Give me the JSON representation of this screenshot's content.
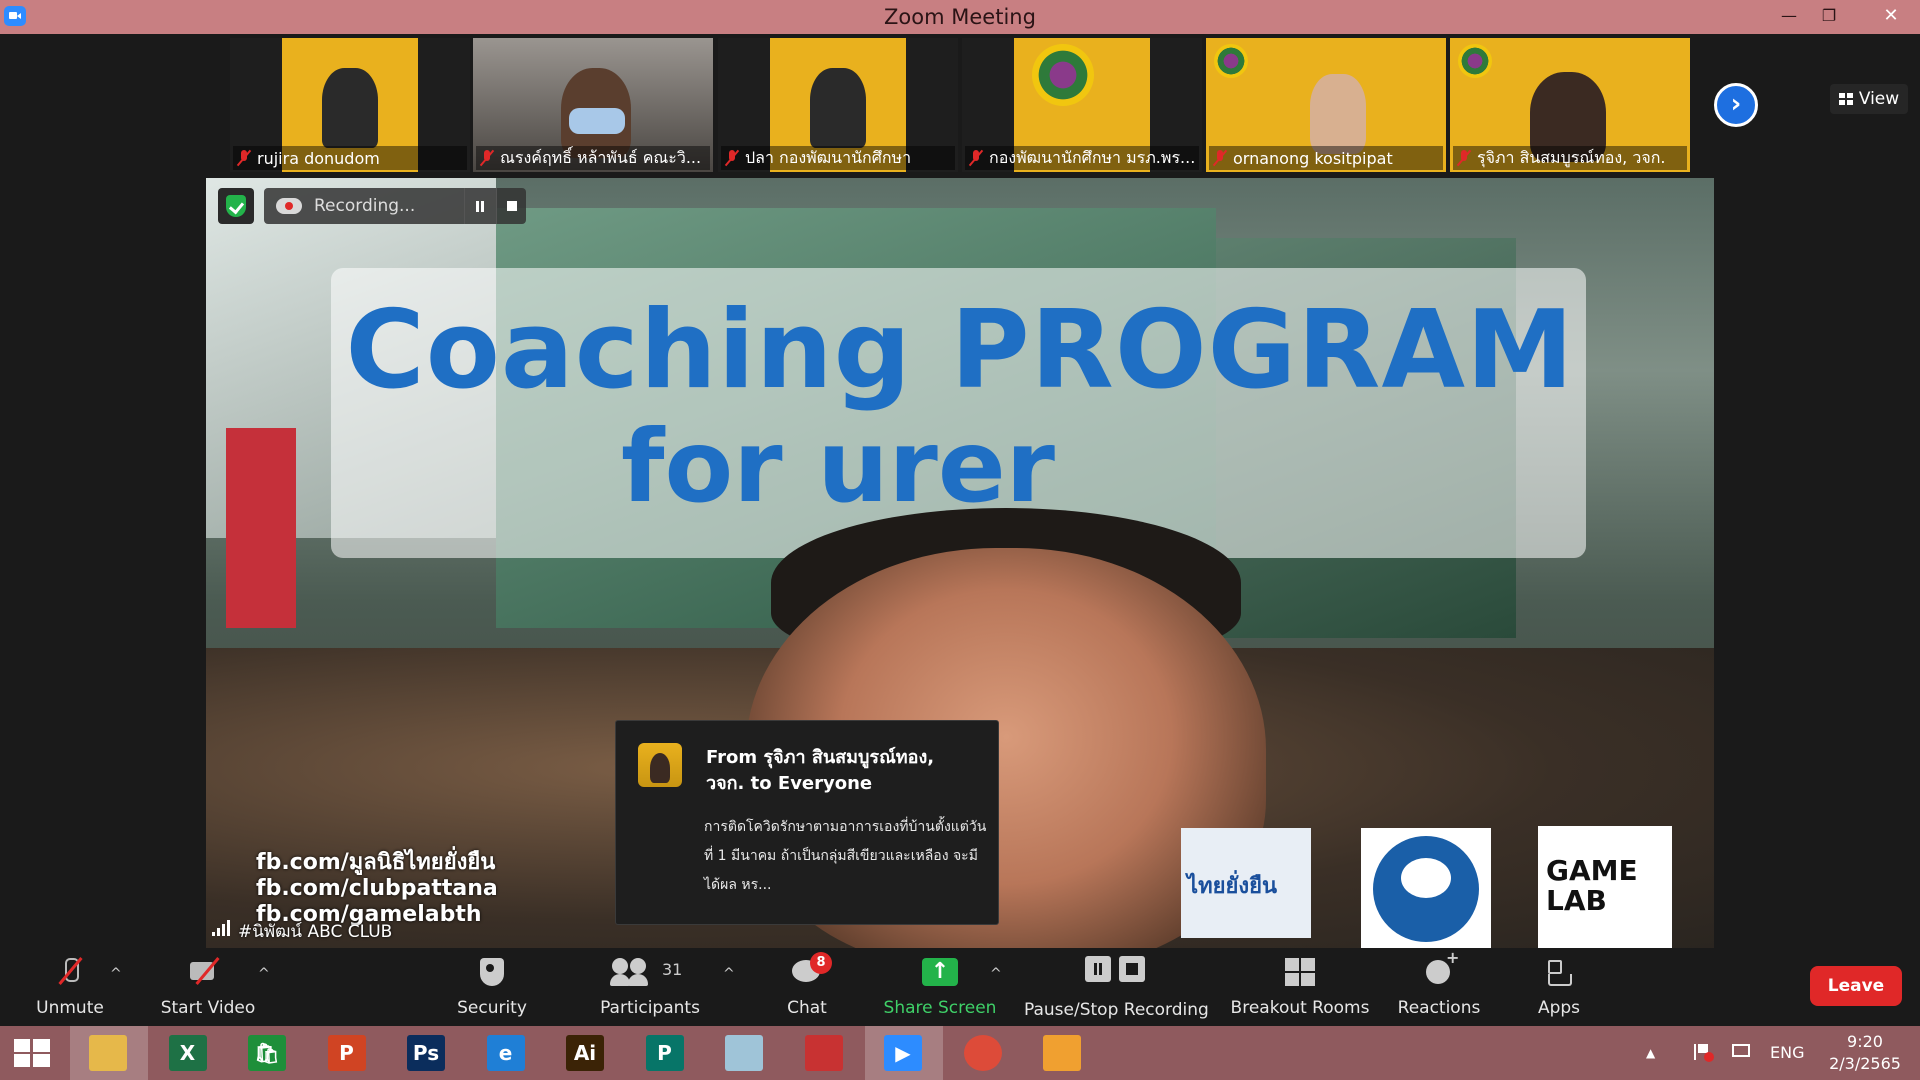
{
  "window": {
    "title": "Zoom Meeting",
    "minimize_glyph": "—",
    "restore_glyph": "❐",
    "close_glyph": "✕"
  },
  "gallery": {
    "participants": [
      {
        "name": "rujira donudom"
      },
      {
        "name": "ณรงค์ฤทธิ์ หล้าพันธ์ คณะวิ..."
      },
      {
        "name": "ปลา กองพัฒนานักศึกษา"
      },
      {
        "name": "กองพัฒนานักศึกษา มรภ.พร..."
      },
      {
        "name": "ornanong kositpipat"
      },
      {
        "name": "รุจิภา สินสมบูรณ์ทอง, วจก."
      }
    ],
    "next_glyph": "›",
    "view_label": "View"
  },
  "main_video": {
    "recording_label": "Recording...",
    "slide_title": "Coaching PROGRAM",
    "slide_subtitle": "for  urer",
    "fb_lines": [
      "fb.com/มูลนิธิไทยยั่งยืน",
      "fb.com/clubpattana",
      "fb.com/gamelabth"
    ],
    "logo_a_text": "ไทยยั่งยืน",
    "logo_c_text": "GAME LAB",
    "speaker_name": "#นิพัฒน์ ABC CLUB"
  },
  "chat_popup": {
    "from": "From รุจิภา สินสมบูรณ์ทอง, วจก. to Everyone",
    "message": "การติดโควิดรักษาตามอาการเองที่บ้านตั้งแต่วันที่ 1 มีนาคม ถ้าเป็นกลุ่มสีเขียวและเหลือง จะมีได้ผล หร..."
  },
  "toolbar": {
    "unmute": "Unmute",
    "start_video": "Start Video",
    "security": "Security",
    "participants": "Participants",
    "participants_count": "31",
    "chat": "Chat",
    "chat_badge": "8",
    "share_screen": "Share Screen",
    "pause_stop": "Pause/Stop Recording",
    "breakout": "Breakout Rooms",
    "reactions": "Reactions",
    "apps": "Apps",
    "leave": "Leave",
    "caret": "^"
  },
  "taskbar": {
    "apps": [
      {
        "name": "File Explorer",
        "glyph": "",
        "color": "#e6b84a"
      },
      {
        "name": "Excel",
        "glyph": "X",
        "color": "#1e7145"
      },
      {
        "name": "Store",
        "glyph": "🛍",
        "color": "#1e8f3a"
      },
      {
        "name": "PowerPoint",
        "glyph": "P",
        "color": "#d04423"
      },
      {
        "name": "Photoshop",
        "glyph": "Ps",
        "color": "#0b2d5c"
      },
      {
        "name": "Internet Explorer",
        "glyph": "e",
        "color": "#1f7fd6"
      },
      {
        "name": "Illustrator",
        "glyph": "Ai",
        "color": "#3b2306"
      },
      {
        "name": "Publisher",
        "glyph": "P",
        "color": "#077568"
      },
      {
        "name": "Notes",
        "glyph": "",
        "color": "#9fc4d8"
      },
      {
        "name": "PhotoScape",
        "glyph": "",
        "color": "#c83232"
      },
      {
        "name": "Zoom",
        "glyph": "▶",
        "color": "#2d8cff"
      },
      {
        "name": "Chrome",
        "glyph": "",
        "color": "#dd4b39"
      },
      {
        "name": "Paint",
        "glyph": "",
        "color": "#f0a030"
      }
    ],
    "tray_arrow": "▲",
    "language": "ENG",
    "time": "9:20",
    "date": "2/3/2565"
  }
}
